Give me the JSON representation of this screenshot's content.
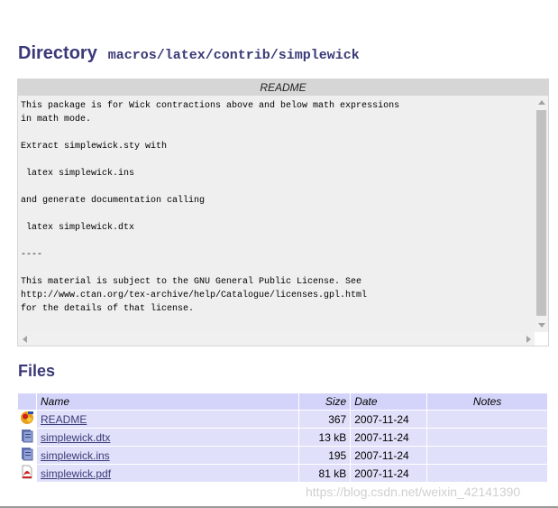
{
  "directory": {
    "title": "Directory",
    "path": "macros/latex/contrib/simplewick"
  },
  "readme": {
    "header": "README",
    "content": "This package is for Wick contractions above and below math expressions\nin math mode.\n\nExtract simplewick.sty with\n\n latex simplewick.ins\n\nand generate documentation calling\n\n latex simplewick.dtx\n\n----\n\nThis material is subject to the GNU General Public License. See\nhttp://www.ctan.org/tex-archive/help/Catalogue/licenses.gpl.html\nfor the details of that license."
  },
  "files": {
    "title": "Files",
    "columns": {
      "name": "Name",
      "size": "Size",
      "date": "Date",
      "notes": "Notes"
    },
    "rows": [
      {
        "icon": "readme-file-icon",
        "name": "README",
        "size": "367",
        "date": "2007-11-24",
        "notes": ""
      },
      {
        "icon": "dtx-file-icon",
        "name": "simplewick.dtx",
        "size": "13 kB",
        "date": "2007-11-24",
        "notes": ""
      },
      {
        "icon": "ins-file-icon",
        "name": "simplewick.ins",
        "size": "195",
        "date": "2007-11-24",
        "notes": ""
      },
      {
        "icon": "pdf-file-icon",
        "name": "simplewick.pdf",
        "size": "81 kB",
        "date": "2007-11-24",
        "notes": ""
      }
    ]
  },
  "watermark": "https://blog.csdn.net/weixin_42141390",
  "colors": {
    "heading": "#3a3a78",
    "table_header": "#d4d4fa",
    "table_row": "#e0e0fa",
    "readme_bg": "#efefef"
  }
}
